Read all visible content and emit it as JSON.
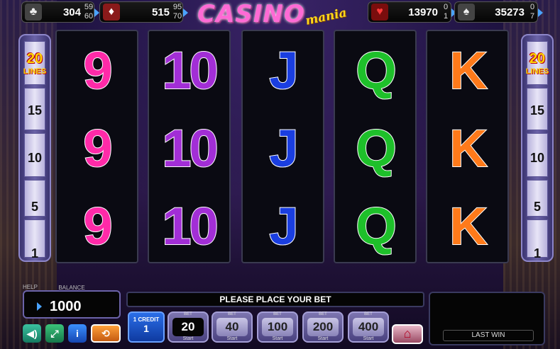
{
  "jackpots": [
    {
      "icon": "club-icon",
      "glyph": "♣",
      "value": "304",
      "top": "59",
      "bottom": "60"
    },
    {
      "icon": "diamond-icon",
      "glyph": "♦",
      "value": "515",
      "top": "95",
      "bottom": "70"
    },
    {
      "icon": "heart-icon",
      "glyph": "♥",
      "value": "13970",
      "top": "0",
      "bottom": "1"
    },
    {
      "icon": "spade-icon",
      "glyph": "♠",
      "value": "35273",
      "top": "0",
      "bottom": "7"
    }
  ],
  "logo": {
    "main": "CASINO",
    "sub": "mania"
  },
  "lines": {
    "top_count": "20",
    "top_word": "LINES",
    "levels": [
      "15",
      "10",
      "5",
      "1"
    ]
  },
  "reels": [
    {
      "symbol": "9",
      "color": "#ff2aa8"
    },
    {
      "symbol": "10",
      "color": "#a22ed6"
    },
    {
      "symbol": "J",
      "color": "#1a3ee0"
    },
    {
      "symbol": "Q",
      "color": "#1ec02a"
    },
    {
      "symbol": "K",
      "color": "#ff7a1a"
    }
  ],
  "balance": {
    "help": "HELP",
    "label": "BALANCE",
    "value": "1000"
  },
  "message": "PLEASE PLACE YOUR BET",
  "credit": {
    "label": "1 CREDIT",
    "value": "1"
  },
  "bets": [
    {
      "label": "BET",
      "value": "20",
      "sub": "Start"
    },
    {
      "label": "BET",
      "value": "40",
      "sub": "Start"
    },
    {
      "label": "BET",
      "value": "100",
      "sub": "Start"
    },
    {
      "label": "BET",
      "value": "200",
      "sub": "Start"
    },
    {
      "label": "BET",
      "value": "400",
      "sub": "Start"
    }
  ],
  "last_win_label": "LAST WIN",
  "buttons": {
    "info": "i"
  }
}
